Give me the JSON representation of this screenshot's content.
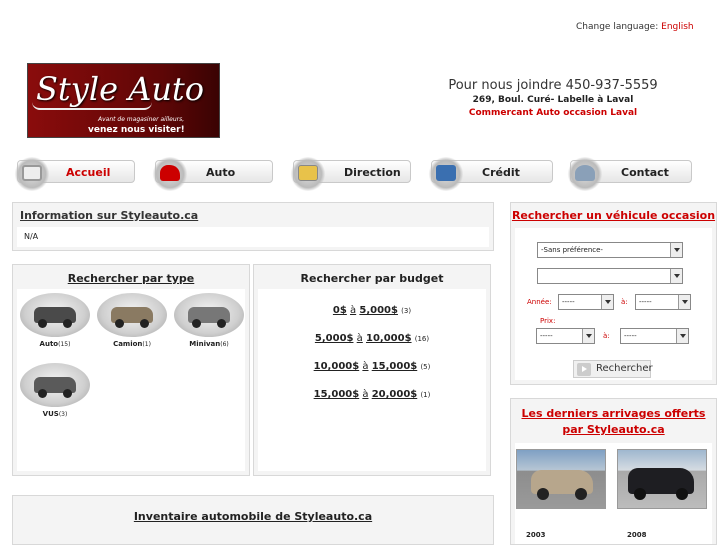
{
  "lang": {
    "prefix": "Change language:",
    "link": "English"
  },
  "logo": {
    "script": "Style Auto",
    "slogan": "Avant de magasiner ailleurs,",
    "visit": "venez nous visiter!"
  },
  "contact": {
    "phone": "Pour nous joindre 450-937-5559",
    "address": "269, Boul. Curé- Labelle à Laval",
    "dealer": "Commercant Auto occasion Laval"
  },
  "nav": [
    {
      "label": "Accueil",
      "icon": "house-icon",
      "active": true
    },
    {
      "label": "Auto",
      "icon": "car-icon",
      "active": false
    },
    {
      "label": "Direction",
      "icon": "map-icon",
      "active": false
    },
    {
      "label": "Crédit",
      "icon": "credit-card-icon",
      "active": false
    },
    {
      "label": "Contact",
      "icon": "person-icon",
      "active": false
    }
  ],
  "info": {
    "title": "Information sur Styleauto.ca",
    "body": "N/A"
  },
  "bytype": {
    "title": "Rechercher par type",
    "items": [
      {
        "label": "Auto",
        "count": "(15)",
        "color": "#4a4a4a"
      },
      {
        "label": "Camion",
        "count": "(1)",
        "color": "#8a7a62"
      },
      {
        "label": "Minivan",
        "count": "(6)",
        "color": "#777777"
      },
      {
        "label": "VUS",
        "count": "(3)",
        "color": "#5a5a5a"
      }
    ]
  },
  "bybudget": {
    "title": "Rechercher par budget",
    "ranges": [
      {
        "from": "0$",
        "sep": "à",
        "to": "5,000$",
        "count": "(3)"
      },
      {
        "from": "5,000$",
        "sep": "à",
        "to": "10,000$",
        "count": "(16)"
      },
      {
        "from": "10,000$",
        "sep": "à",
        "to": "15,000$",
        "count": "(5)"
      },
      {
        "from": "15,000$",
        "sep": "à",
        "to": "20,000$",
        "count": "(1)"
      }
    ]
  },
  "inventory": {
    "title": "Inventaire automobile de Styleauto.ca"
  },
  "search": {
    "title": "Rechercher un véhicule occasion",
    "make": "-Sans préférence-",
    "model": "",
    "year_label": "Année:",
    "to_label": "à:",
    "price_label": "Prix:",
    "dash": "-----",
    "button": "Rechercher"
  },
  "arrivals": {
    "title": "Les derniers arrivages offerts par Styleauto.ca",
    "items": [
      {
        "year": "2003"
      },
      {
        "year": "2008"
      }
    ]
  },
  "colors": {
    "accent": "#cc0000",
    "panel": "#f4f4f4"
  }
}
